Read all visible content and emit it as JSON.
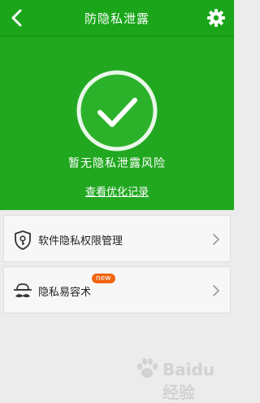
{
  "header": {
    "title": "防隐私泄露",
    "back_icon": "back-arrow-icon",
    "settings_icon": "gear-icon"
  },
  "hero": {
    "status_text": "暂无隐私泄露风险",
    "link_text": "查看优化记录",
    "icon": "check-circle-icon"
  },
  "items": [
    {
      "label": "软件隐私权限管理",
      "icon": "shield-key-icon"
    },
    {
      "label": "隐私易容术",
      "icon": "disguise-icon",
      "badge": "new"
    }
  ],
  "watermark": {
    "text": "Baidu 经验",
    "icon": "paw-icon"
  },
  "colors": {
    "accent": "#21a820",
    "badge": "#f0640f"
  }
}
